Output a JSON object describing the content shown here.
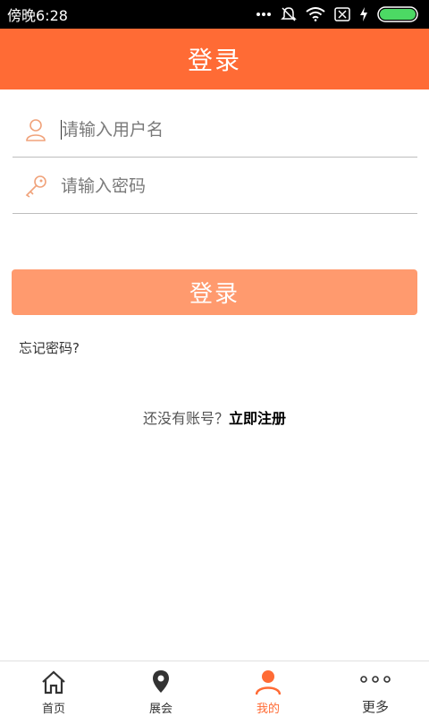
{
  "status_bar": {
    "time": "傍晚6:28",
    "battery_color": "#4CD964"
  },
  "header": {
    "title": "登录",
    "background": "#FF6B35"
  },
  "form": {
    "username_placeholder": "请输入用户名",
    "password_placeholder": "请输入密码",
    "username_icon": "user-icon",
    "password_icon": "key-icon",
    "submit_label": "登录",
    "submit_color": "#FF9A6E"
  },
  "links": {
    "forgot_password": "忘记密码?",
    "no_account": "还没有账号？",
    "register": "立即注册"
  },
  "tabs": [
    {
      "label": "首页",
      "icon": "home-icon",
      "active": false
    },
    {
      "label": "展会",
      "icon": "location-pin-icon",
      "active": false
    },
    {
      "label": "我的",
      "icon": "user-icon",
      "active": true
    },
    {
      "label": "更多",
      "icon": "more-dots-icon",
      "active": false
    }
  ],
  "colors": {
    "accent": "#FF6B35",
    "icon_outline": "#F0A27A"
  }
}
